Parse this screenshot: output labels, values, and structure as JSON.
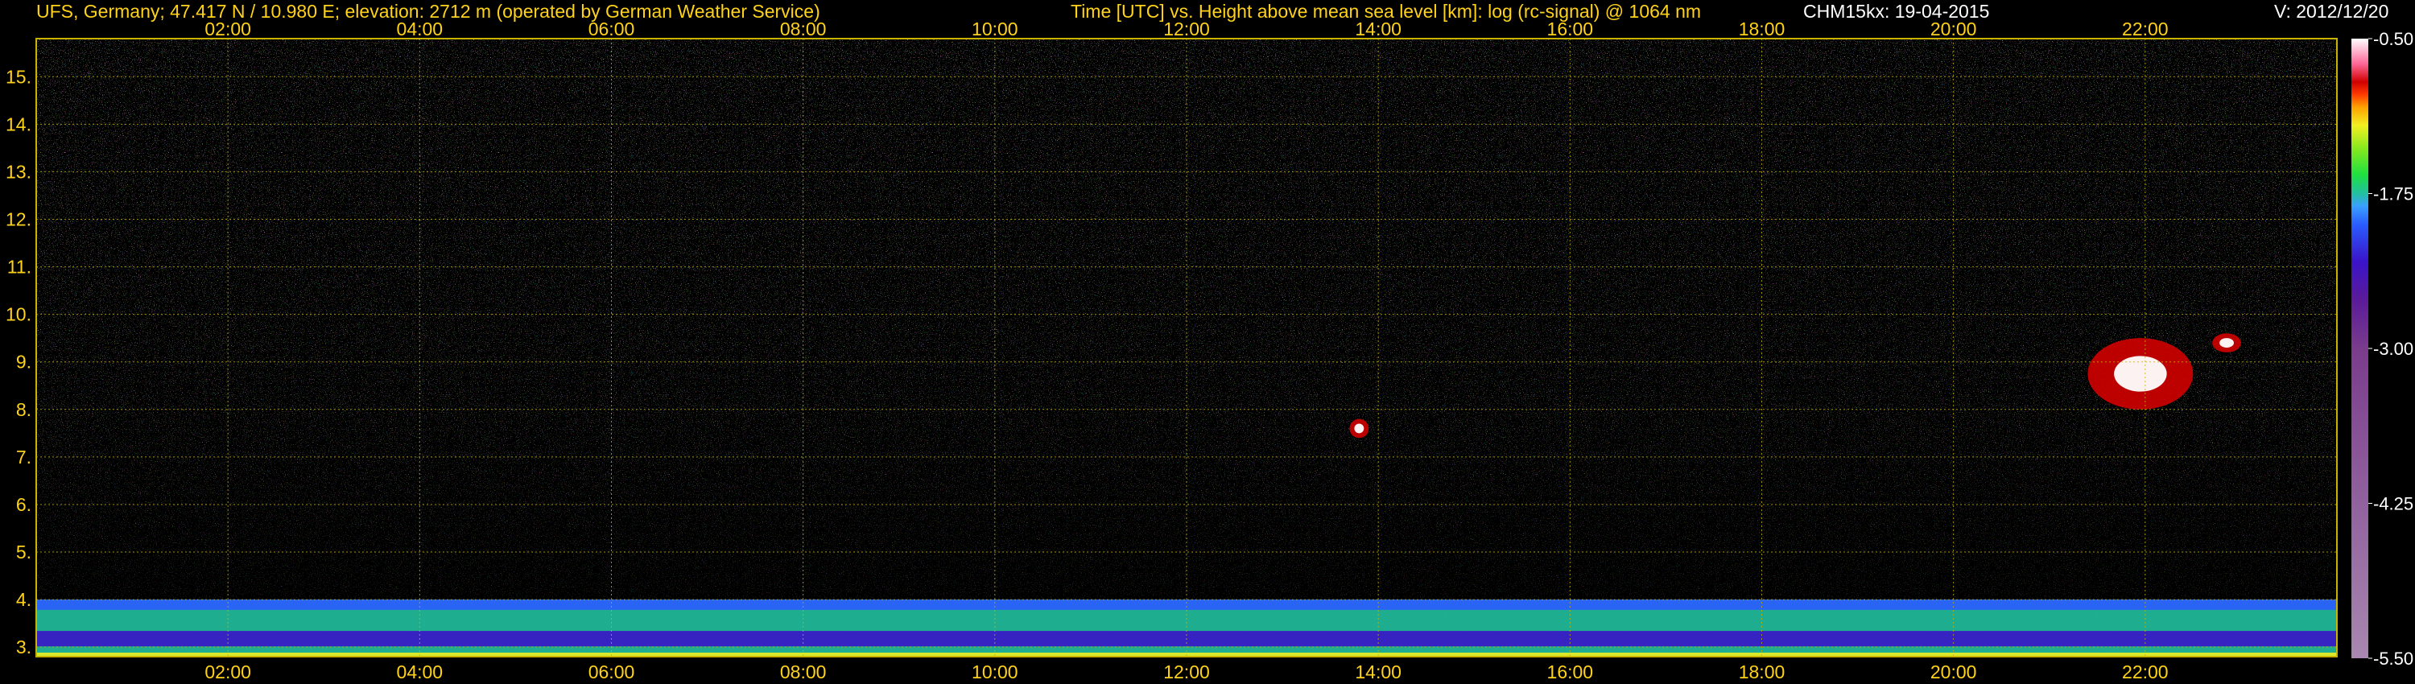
{
  "header": {
    "site": "UFS, Germany; 47.417 N / 10.980 E; elevation: 2712 m  (operated by German Weather Service)",
    "axes_title": "Time [UTC] vs. Height above mean sea level [km]: log (rc-signal) @ 1064 nm",
    "instrument": "CHM15kx: 19-04-2015",
    "version": "V: 2012/12/20"
  },
  "colors": {
    "background": "#000000",
    "axis_text": "#ffd21a",
    "frame": "#c8b400",
    "grid": "#c8b400"
  },
  "chart_data": {
    "type": "heatmap",
    "title": "Time [UTC] vs. Height above mean sea level [km]: log (rc-signal) @ 1064 nm",
    "xlabel": "Time [UTC]",
    "ylabel": "Height above mean sea level [km]",
    "x_range_hours": [
      0,
      24
    ],
    "x_ticks": [
      "02:00",
      "04:00",
      "06:00",
      "08:00",
      "10:00",
      "12:00",
      "14:00",
      "16:00",
      "18:00",
      "20:00",
      "22:00"
    ],
    "x_tick_hours": [
      2,
      4,
      6,
      8,
      10,
      12,
      14,
      16,
      18,
      20,
      22
    ],
    "ylim": [
      2.8,
      15.8
    ],
    "y_ticks": [
      "3.",
      "4.",
      "5.",
      "6.",
      "7.",
      "8.",
      "9.",
      "10.",
      "11.",
      "12.",
      "13.",
      "14.",
      "15."
    ],
    "y_tick_values": [
      3,
      4,
      5,
      6,
      7,
      8,
      9,
      10,
      11,
      12,
      13,
      14,
      15
    ],
    "grid": true,
    "colorbar": {
      "label": "log (rc-signal)",
      "range": [
        -5.5,
        -0.5
      ],
      "ticks": [
        "-0.50",
        "-1.75",
        "-3.00",
        "-4.25",
        "-5.50"
      ],
      "tick_values": [
        -0.5,
        -1.75,
        -3.0,
        -4.25,
        -5.5
      ],
      "palette": [
        "#a888b0",
        "#7a3c8c",
        "#5a1a9a",
        "#3a14c8",
        "#2a5cff",
        "#3aa0ff",
        "#22c0a0",
        "#1ee040",
        "#80e820",
        "#f0f020",
        "#ffa000",
        "#ff3a00",
        "#d00000",
        "#ff6a9a",
        "#ffffff"
      ],
      "palette_stops": [
        -5.5,
        -3.0,
        -2.6,
        -2.3,
        -2.0,
        -1.85,
        -1.75,
        -1.6,
        -1.4,
        -1.2,
        -1.05,
        -0.95,
        -0.85,
        -0.7,
        -0.5
      ]
    },
    "features": [
      {
        "name": "boundary layer",
        "start_hour": 0,
        "end_hour": 24,
        "base_km": 2.8,
        "top_km": 4.0
      },
      {
        "name": "cirrus cloud",
        "start_hour": 21.4,
        "end_hour": 22.5,
        "base_km": 8.0,
        "top_km": 9.5
      },
      {
        "name": "small cloud",
        "start_hour": 22.7,
        "end_hour": 23.0,
        "base_km": 9.2,
        "top_km": 9.6
      },
      {
        "name": "small cloud",
        "start_hour": 13.7,
        "end_hour": 13.9,
        "base_km": 7.4,
        "top_km": 7.8
      }
    ]
  }
}
